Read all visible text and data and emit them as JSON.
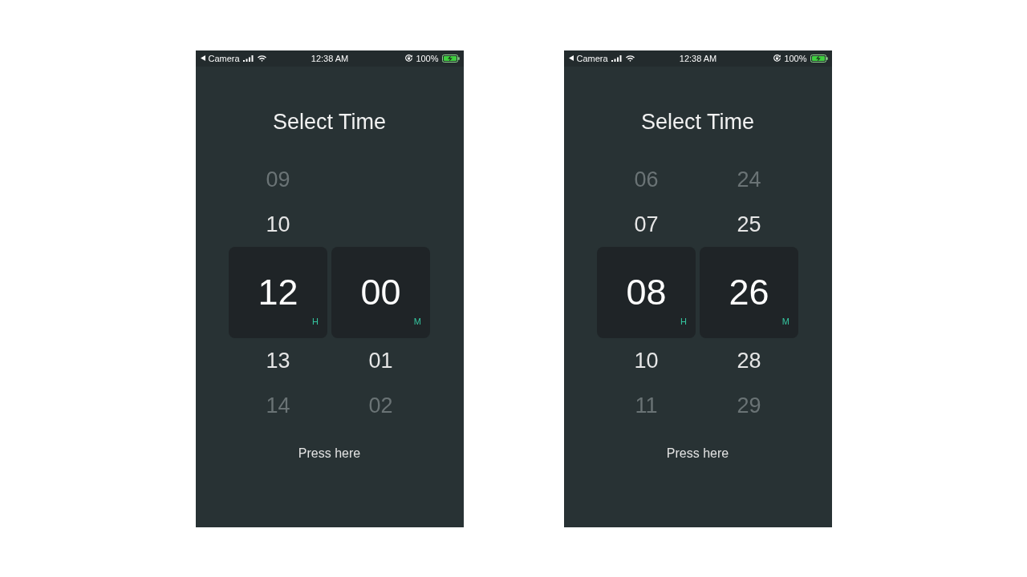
{
  "screens": [
    {
      "status_bar": {
        "back_label": "Camera",
        "time": "12:38 AM",
        "battery": "100%"
      },
      "title": "Select Time",
      "wheels": [
        {
          "above": [
            "09",
            "10"
          ],
          "value": "12",
          "unit": "H",
          "below": [
            "13",
            "14"
          ]
        },
        {
          "value": "00",
          "unit": "M",
          "below": [
            "01",
            "02"
          ]
        }
      ],
      "button": "Press here"
    },
    {
      "status_bar": {
        "back_label": "Camera",
        "time": "12:38 AM",
        "battery": "100%"
      },
      "title": "Select Time",
      "wheels": [
        {
          "above": [
            "06",
            "07"
          ],
          "value": "08",
          "unit": "H",
          "below": [
            "10",
            "11"
          ]
        },
        {
          "above": [
            "24",
            "25"
          ],
          "value": "26",
          "unit": "M",
          "below": [
            "28",
            "29"
          ]
        }
      ],
      "button": "Press here"
    }
  ]
}
